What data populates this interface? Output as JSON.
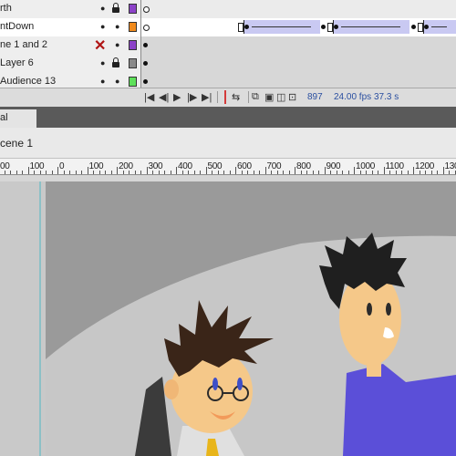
{
  "timeline": {
    "layers": [
      {
        "name": "rth",
        "color": "#8c42c8"
      },
      {
        "name": "ntDown",
        "color": "#f08a1c",
        "selected": true
      },
      {
        "name": "ne 1 and 2",
        "color": "#8c42c8",
        "hidden": true
      },
      {
        "name": "Layer 6",
        "color": "#8a8a8a"
      },
      {
        "name": "Audience 13",
        "color": "#5ee05a"
      }
    ],
    "controls": {
      "current_frame": "897",
      "fps": "24.00 fps",
      "time": "37.3 s"
    }
  },
  "panel": {
    "tab_label": "al"
  },
  "scene": {
    "name": "cene 1"
  },
  "ruler": {
    "labels": [
      "00",
      "100",
      "0",
      "100",
      "200",
      "300",
      "400",
      "500",
      "600",
      "700",
      "800",
      "900",
      "1000",
      "1100",
      "1200",
      "130"
    ]
  },
  "colors": {
    "stage_bg": "#c9c9c9",
    "canvas_dark": "#9a9a9a",
    "canvas_light": "#c7c7c7",
    "shirt_blue": "#5b4fd8",
    "skin": "#f5c889",
    "hair_dark": "#1f1f1f",
    "hair_brown": "#3a2518"
  }
}
